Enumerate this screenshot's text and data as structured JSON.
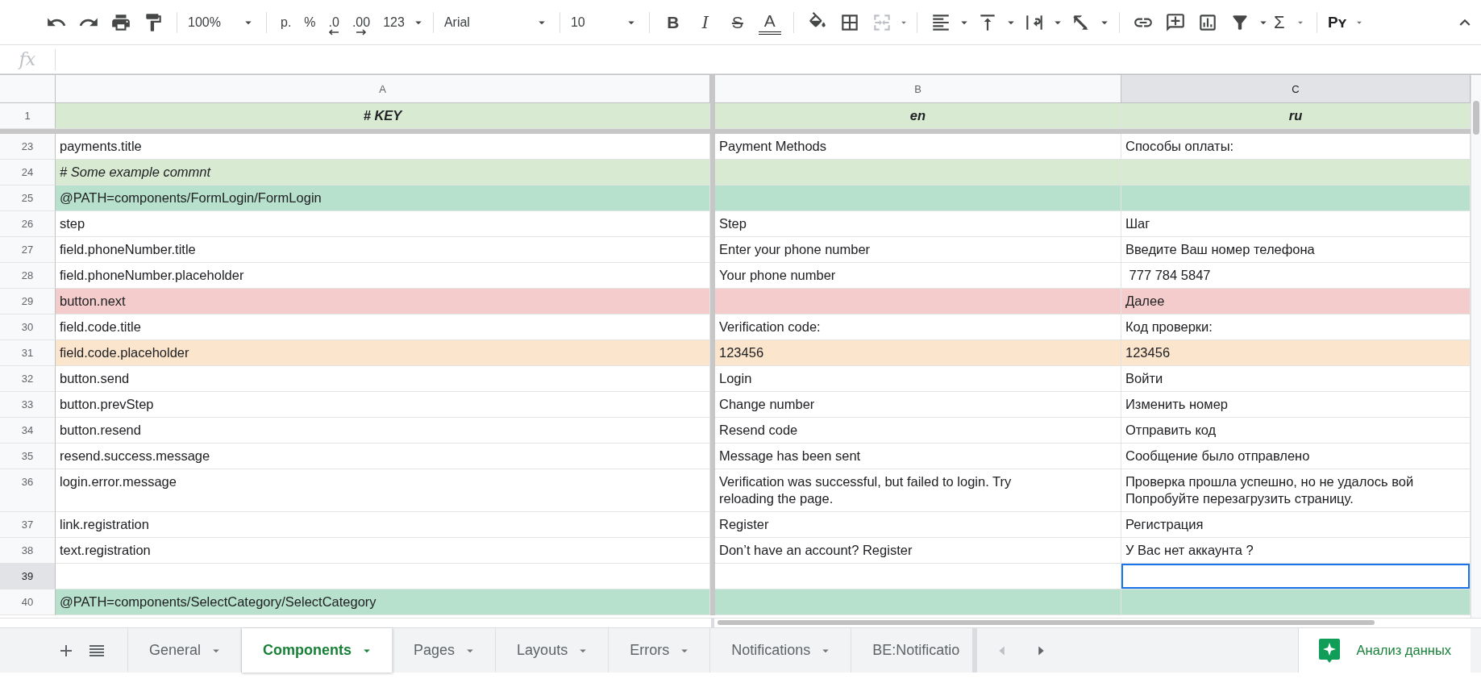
{
  "toolbar": {
    "zoom": "100%",
    "number_formats": [
      "р.",
      "%",
      ".0",
      ".00",
      "123"
    ],
    "font": "Arial",
    "font_size": "10",
    "text_styles": [
      "B",
      "I",
      "S",
      "A"
    ],
    "merge_disabled": true,
    "function": "Σ",
    "input_tools": "Pʏ"
  },
  "formula_bar": {
    "label": "fx"
  },
  "columns": [
    {
      "label": "A",
      "selected": false
    },
    {
      "label": "B",
      "selected": false
    },
    {
      "label": "C",
      "selected": true
    }
  ],
  "rows": [
    {
      "number": "1",
      "kind": "header",
      "italic": true,
      "color": "#d9ead3",
      "cells": [
        {
          "text": "# KEY",
          "selected": false
        },
        {
          "text": "en",
          "selected": false
        },
        {
          "text": "ru",
          "selected": false
        }
      ]
    },
    {
      "number": "23",
      "kind": "entry",
      "italic": false,
      "color": "#ffffff",
      "cells": [
        {
          "text": "payments.title",
          "selected": false
        },
        {
          "text": "Payment Methods",
          "selected": false
        },
        {
          "text": "Способы оплаты:",
          "selected": false
        }
      ]
    },
    {
      "number": "24",
      "kind": "entry",
      "italic": true,
      "color": "#d9ead3",
      "cells": [
        {
          "text": "# Some example commnt",
          "selected": false
        },
        {
          "selected": false
        },
        {
          "selected": false
        }
      ]
    },
    {
      "number": "25",
      "kind": "entry",
      "italic": false,
      "color": "#b7e1cd",
      "cells": [
        {
          "text": "@PATH=components/FormLogin/FormLogin",
          "selected": false
        },
        {
          "selected": false
        },
        {
          "selected": false
        }
      ]
    },
    {
      "number": "26",
      "kind": "entry",
      "italic": false,
      "color": "#ffffff",
      "cells": [
        {
          "text": "step",
          "selected": false
        },
        {
          "text": "Step",
          "selected": false
        },
        {
          "text": "Шаг",
          "selected": false
        }
      ]
    },
    {
      "number": "27",
      "kind": "entry",
      "italic": false,
      "color": "#ffffff",
      "cells": [
        {
          "text": "field.phoneNumber.title",
          "selected": false
        },
        {
          "text": "Enter your phone number",
          "selected": false
        },
        {
          "text": "Введите Ваш номер телефона",
          "selected": false
        }
      ]
    },
    {
      "number": "28",
      "kind": "entry",
      "italic": false,
      "color": "#ffffff",
      "cells": [
        {
          "text": "field.phoneNumber.placeholder",
          "selected": false
        },
        {
          "text": "Your phone number",
          "selected": false
        },
        {
          "text": " 777 784 5847",
          "selected": false
        }
      ]
    },
    {
      "number": "29",
      "kind": "entry",
      "italic": false,
      "color": "#f4cccc",
      "cells": [
        {
          "text": "button.next",
          "selected": false
        },
        {
          "selected": false
        },
        {
          "text": "Далее",
          "selected": false
        }
      ]
    },
    {
      "number": "30",
      "kind": "entry",
      "italic": false,
      "color": "#ffffff",
      "cells": [
        {
          "text": "field.code.title",
          "selected": false
        },
        {
          "text": "Verification code:",
          "selected": false
        },
        {
          "text": "Код проверки:",
          "selected": false
        }
      ]
    },
    {
      "number": "31",
      "kind": "entry",
      "italic": false,
      "color": "#fce5cd",
      "cells": [
        {
          "text": "field.code.placeholder",
          "selected": false
        },
        {
          "text": "123456",
          "selected": false
        },
        {
          "text": "123456",
          "selected": false
        }
      ]
    },
    {
      "number": "32",
      "kind": "entry",
      "italic": false,
      "color": "#ffffff",
      "cells": [
        {
          "text": "button.send",
          "selected": false
        },
        {
          "text": "Login",
          "selected": false
        },
        {
          "text": "Войти",
          "selected": false
        }
      ]
    },
    {
      "number": "33",
      "kind": "entry",
      "italic": false,
      "color": "#ffffff",
      "cells": [
        {
          "text": "button.prevStep",
          "selected": false
        },
        {
          "text": "Change number",
          "selected": false
        },
        {
          "text": "Изменить номер",
          "selected": false
        }
      ]
    },
    {
      "number": "34",
      "kind": "entry",
      "italic": false,
      "color": "#ffffff",
      "cells": [
        {
          "text": "button.resend",
          "selected": false
        },
        {
          "text": "Resend code",
          "selected": false
        },
        {
          "text": "Отправить код",
          "selected": false
        }
      ]
    },
    {
      "number": "35",
      "kind": "entry",
      "italic": false,
      "color": "#ffffff",
      "cells": [
        {
          "text": "resend.success.message",
          "selected": false
        },
        {
          "text": "Message has been sent",
          "selected": false
        },
        {
          "text": "Сообщение было отправлено",
          "selected": false
        }
      ]
    },
    {
      "number": "36",
      "kind": "entry",
      "italic": false,
      "color": "#ffffff",
      "cells": [
        {
          "text": "login.error.message",
          "selected": false
        },
        {
          "text": "Verification was successful, but failed to login. Try\nreloading the page.",
          "selected": false
        },
        {
          "text": "Проверка прошла успешно, но не удалось вой\nПопробуйте перезагрузить страницу.",
          "selected": false
        }
      ]
    },
    {
      "number": "37",
      "kind": "entry",
      "italic": false,
      "color": "#ffffff",
      "cells": [
        {
          "text": "link.registration",
          "selected": false
        },
        {
          "text": "Register",
          "selected": false
        },
        {
          "text": "Регистрация",
          "selected": false
        }
      ]
    },
    {
      "number": "38",
      "kind": "entry",
      "italic": false,
      "color": "#ffffff",
      "cells": [
        {
          "text": "text.registration",
          "selected": false
        },
        {
          "text": "Don’t have an account? Register",
          "selected": false
        },
        {
          "text": "У Вас нет аккаунта ?",
          "selected": false
        }
      ]
    },
    {
      "number": "39",
      "kind": "entry",
      "italic": false,
      "color": "#ffffff",
      "cells": [
        {
          "selected": false
        },
        {
          "selected": false
        },
        {
          "selected": true
        }
      ]
    },
    {
      "number": "40",
      "kind": "entry",
      "italic": false,
      "color": "#b7e1cd",
      "cells": [
        {
          "text": "@PATH=components/SelectCategory/SelectCategory",
          "selected": false
        },
        {
          "selected": false
        },
        {
          "selected": false
        }
      ]
    }
  ],
  "sheet_tabs": [
    {
      "label": "General",
      "selected": false
    },
    {
      "label": "Components",
      "selected": true
    },
    {
      "label": "Pages",
      "selected": false
    },
    {
      "label": "Layouts",
      "selected": false
    },
    {
      "label": "Errors",
      "selected": false
    },
    {
      "label": "Notifications",
      "selected": false
    },
    {
      "label": "BE:Notificatio",
      "selected": false
    }
  ],
  "explore_button": {
    "label": "Анализ данных"
  }
}
